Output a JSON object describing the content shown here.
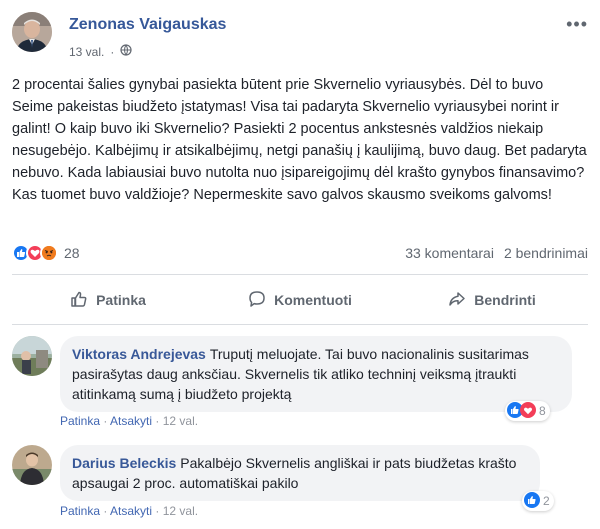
{
  "post": {
    "author": "Zenonas Vaigauskas",
    "time": "13 val.",
    "separator": "·",
    "text": "2 procentai šalies gynybai pasiekta būtent prie Skvernelio vyriausybės. Dėl to buvo Seime pakeistas biudžeto įstatymas! Visa tai padaryta Skvernelio vyriausybei norint ir galint! O kaip buvo iki Skvernelio? Pasiekti 2 pocentus ankstesnės valdžios niekaip nesugebėjo. Kalbėjimų ir atsikalbėjimų, netgi panašių į kaulijimą, buvo daug. Bet padaryta nebuvo. Kada labiausiai buvo nutolta nuo įsipareigojimų dėl krašto gynybos finansavimo? Kas tuomet buvo valdžioje? Nepermeskite savo galvos skausmo sveikoms galvoms!",
    "reaction_count": "28",
    "comments_count": "33 komentarai",
    "shares_count": "2 bendrinimai"
  },
  "actions": {
    "like": "Patinka",
    "comment": "Komentuoti",
    "share": "Bendrinti"
  },
  "comments": [
    {
      "name": "Viktoras Andrejevas",
      "text": "Truputį meluojate. Tai buvo nacionalinis susitarimas pasirašytas daug anksčiau. Skvernelis tik atliko techninį veiksmą įtraukti atitinkamą sumą į biudžeto projektą",
      "like": "Patinka",
      "reply": "Atsakyti",
      "time": "12 val.",
      "reactions": "8"
    },
    {
      "name": "Darius Beleckis",
      "text": "Pakalbėjo Skvernelis angliškai ir pats biudžetas krašto apsaugai 2 proc. automatiškai pakilo",
      "like": "Patinka",
      "reply": "Atsakyti",
      "time": "12 val.",
      "reactions": "2"
    }
  ],
  "colors": {
    "name": "#365899",
    "like_blue": "#1877f2",
    "love_red": "#f33e58",
    "angry_orange": "#e9710f"
  },
  "icons": [
    "globe-icon",
    "more-icon",
    "like-reaction-icon",
    "love-reaction-icon",
    "angry-reaction-icon",
    "thumbs-up-icon",
    "comment-icon",
    "share-icon"
  ]
}
